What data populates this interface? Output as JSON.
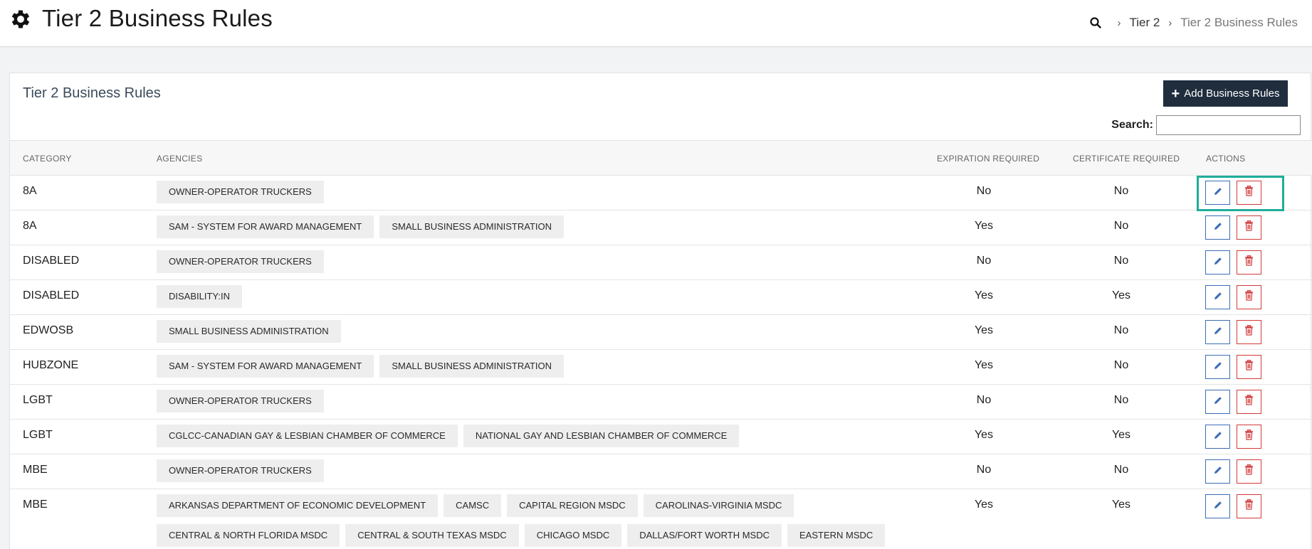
{
  "header": {
    "title": "Tier 2 Business Rules",
    "breadcrumb": [
      {
        "label": "Tier 2"
      },
      {
        "label": "Tier 2 Business Rules"
      }
    ]
  },
  "card": {
    "title": "Tier 2 Business Rules",
    "add_button_label": "Add Business Rules",
    "search_label": "Search:",
    "search_value": ""
  },
  "table": {
    "columns": [
      "CATEGORY",
      "AGENCIES",
      "EXPIRATION REQUIRED",
      "CERTIFICATE REQUIRED",
      "ACTIONS"
    ],
    "rows": [
      {
        "category": "8A",
        "agencies": [
          "OWNER-OPERATOR TRUCKERS"
        ],
        "expiration": "No",
        "certificate": "No"
      },
      {
        "category": "8A",
        "agencies": [
          "SAM - SYSTEM FOR AWARD MANAGEMENT",
          "SMALL BUSINESS ADMINISTRATION"
        ],
        "expiration": "Yes",
        "certificate": "No"
      },
      {
        "category": "DISABLED",
        "agencies": [
          "OWNER-OPERATOR TRUCKERS"
        ],
        "expiration": "No",
        "certificate": "No"
      },
      {
        "category": "DISABLED",
        "agencies": [
          "DISABILITY:IN"
        ],
        "expiration": "Yes",
        "certificate": "Yes"
      },
      {
        "category": "EDWOSB",
        "agencies": [
          "SMALL BUSINESS ADMINISTRATION"
        ],
        "expiration": "Yes",
        "certificate": "No"
      },
      {
        "category": "HUBZONE",
        "agencies": [
          "SAM - SYSTEM FOR AWARD MANAGEMENT",
          "SMALL BUSINESS ADMINISTRATION"
        ],
        "expiration": "Yes",
        "certificate": "No"
      },
      {
        "category": "LGBT",
        "agencies": [
          "OWNER-OPERATOR TRUCKERS"
        ],
        "expiration": "No",
        "certificate": "No"
      },
      {
        "category": "LGBT",
        "agencies": [
          "CGLCC-CANADIAN GAY & LESBIAN CHAMBER OF COMMERCE",
          "NATIONAL GAY AND LESBIAN CHAMBER OF COMMERCE"
        ],
        "expiration": "Yes",
        "certificate": "Yes"
      },
      {
        "category": "MBE",
        "agencies": [
          "OWNER-OPERATOR TRUCKERS"
        ],
        "expiration": "No",
        "certificate": "No"
      },
      {
        "category": "MBE",
        "agencies": [
          "ARKANSAS DEPARTMENT OF ECONOMIC DEVELOPMENT",
          "CAMSC",
          "CAPITAL REGION MSDC",
          "CAROLINAS-VIRGINIA MSDC",
          "CENTRAL & NORTH FLORIDA MSDC",
          "CENTRAL & SOUTH TEXAS MSDC",
          "CHICAGO MSDC",
          "DALLAS/FORT WORTH MSDC",
          "EASTERN MSDC"
        ],
        "expiration": "Yes",
        "certificate": "Yes"
      }
    ]
  },
  "colors": {
    "header_bg": "#ffffff",
    "page_bg": "#f1f3f4",
    "button_dark": "#1f2d3d",
    "edit_blue": "#3a6db5",
    "delete_red": "#d23a3a",
    "highlight_teal": "#1fae9a"
  },
  "icons": {
    "header": "gear-icon",
    "breadcrumb": "search-icon",
    "add": "plus-icon",
    "edit": "pencil-icon",
    "delete": "trash-icon"
  }
}
